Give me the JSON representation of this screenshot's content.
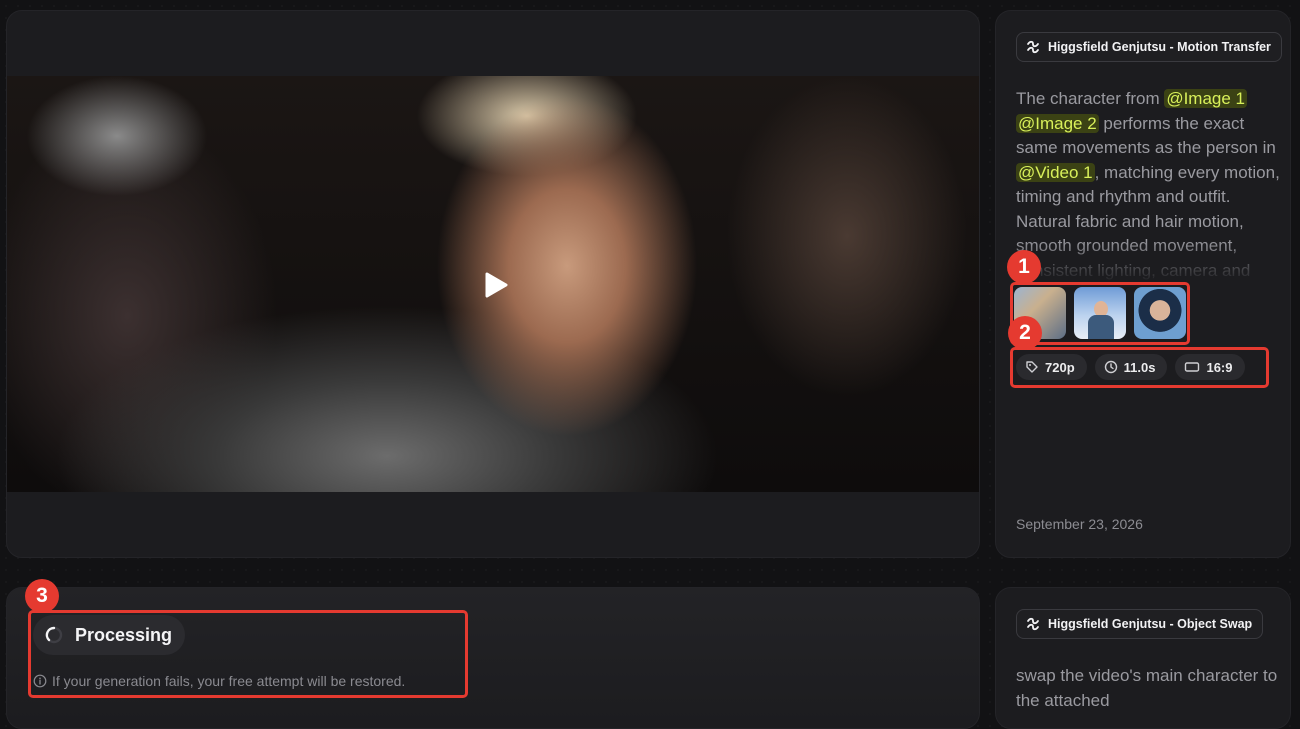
{
  "video_card": {
    "play_icon": "play-icon"
  },
  "info_card_1": {
    "model": "Higgsfield Genjutsu - Motion Transfer",
    "prompt": {
      "t1": "The character from ",
      "m1": "@Image 1",
      "t2": " ",
      "m2": "@Image 2",
      "t3": " performs the exact same movements as the person in ",
      "m3": "@Video 1",
      "t4": ", matching every motion, timing and rhythm and outfit. Natural fabric and hair motion, smooth grounded movement, consistent lighting, camera and"
    },
    "params": {
      "resolution": "720p",
      "duration": "11.0s",
      "aspect": "16:9"
    },
    "date": "September 23, 2026"
  },
  "processing_card": {
    "status": "Processing",
    "note": "If your generation fails, your free attempt will be restored."
  },
  "info_card_2": {
    "model": "Higgsfield Genjutsu - Object Swap",
    "prompt": "swap the video's main character to the attached"
  },
  "annotations": {
    "n1": "1",
    "n2": "2",
    "n3": "3"
  },
  "colors": {
    "accent_mention_bg": "#3b4214",
    "accent_mention_text": "#d8f05a",
    "annotation": "#e53a30"
  }
}
